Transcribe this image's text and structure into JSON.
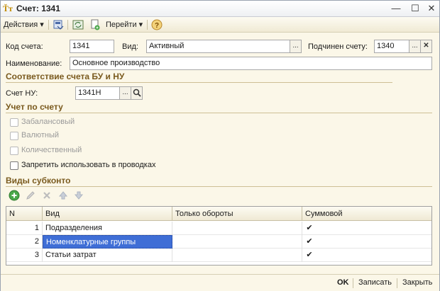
{
  "window": {
    "title": "Счет: 1341",
    "app_icon_glyph": "Ťт"
  },
  "toolbar": {
    "actions_label": "Действия",
    "goto_label": "Перейти",
    "help_glyph": "?"
  },
  "fields": {
    "code_label": "Код счета:",
    "code_value": "1341",
    "kind_label": "Вид:",
    "kind_value": "Активный",
    "parent_label": "Подчинен счету:",
    "parent_value": "1340",
    "name_label": "Наименование:",
    "name_value": "Основное производство"
  },
  "section_bu_nu": {
    "title": "Соответствие счета БУ и НУ",
    "nu_label": "Счет НУ:",
    "nu_value": "1341Н"
  },
  "section_accounting": {
    "title": "Учет по счету",
    "checkboxes": [
      {
        "label": "Забалансовый",
        "enabled": false,
        "checked": false
      },
      {
        "label": "Валютный",
        "enabled": false,
        "checked": false
      },
      {
        "label": "Количественный",
        "enabled": false,
        "checked": false
      },
      {
        "label": "Запретить использовать в проводках",
        "enabled": true,
        "checked": false
      }
    ]
  },
  "section_subconto": {
    "title": "Виды субконто",
    "columns": [
      "N",
      "Вид",
      "Только обороты",
      "Суммовой"
    ],
    "rows": [
      {
        "n": "1",
        "kind": "Подразделения",
        "turnover_only": "",
        "sum": "✔"
      },
      {
        "n": "2",
        "kind": "Номенклатурные группы",
        "turnover_only": "",
        "sum": "✔"
      },
      {
        "n": "3",
        "kind": "Статьи затрат",
        "turnover_only": "",
        "sum": "✔"
      }
    ],
    "selected_row": 1
  },
  "bottom": {
    "ok_label": "OK",
    "save_label": "Записать",
    "close_label": "Закрыть"
  },
  "colors": {
    "section_title": "#7a5a1e",
    "selection": "#3f6ed6",
    "background": "#fbf7e8"
  }
}
